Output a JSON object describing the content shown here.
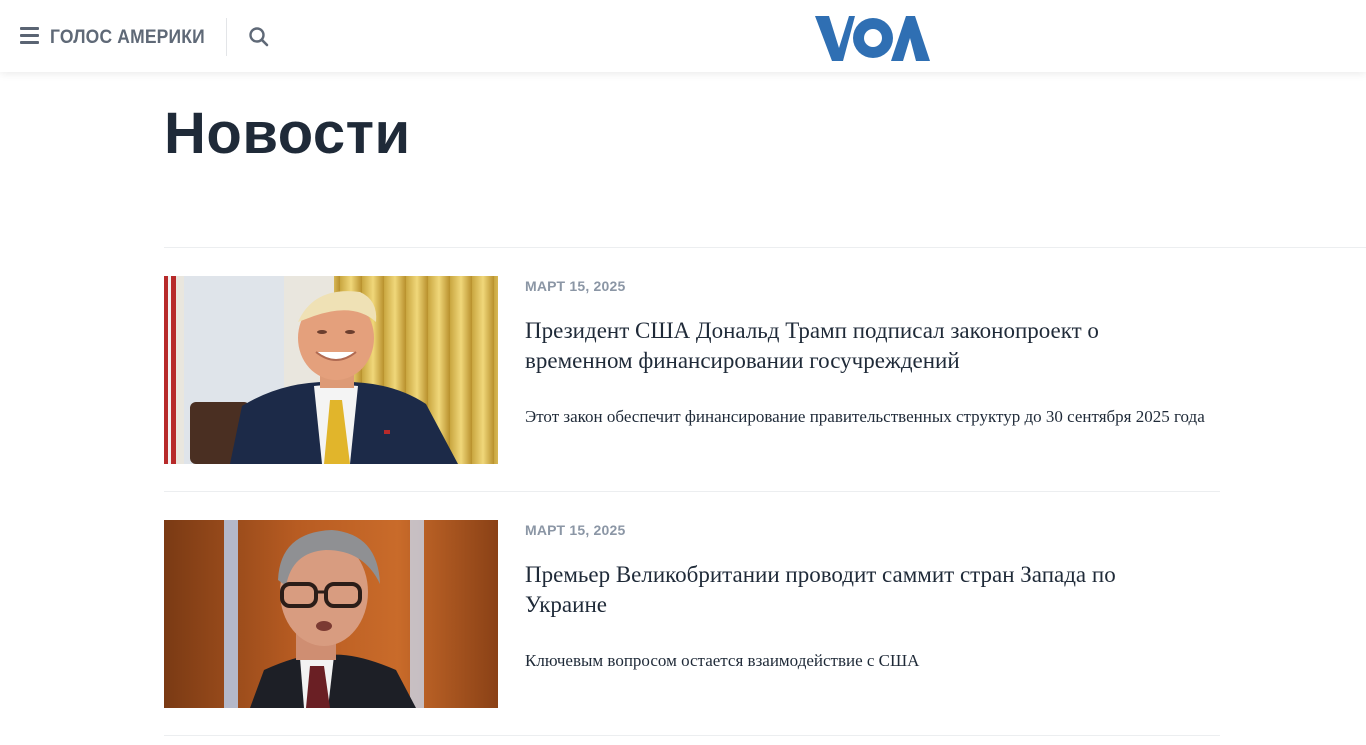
{
  "header": {
    "site_name": "ГОЛОС АМЕРИКИ",
    "logo_text": "VOA",
    "brand_color": "#2f6fb3",
    "menu_icon": "hamburger-menu-icon",
    "search_icon": "search-icon"
  },
  "page": {
    "title": "Новости"
  },
  "articles": [
    {
      "date": "МАРТ 15, 2025",
      "headline": "Президент США Дональд Трамп подписал законопроект о временном финансировании госучреждений",
      "teaser": "Этот закон обеспечит финансирование правительственных структур до 30 сентября 2025 года",
      "image": "photo-smiling-man-oval-office"
    },
    {
      "date": "МАРТ 15, 2025",
      "headline": "Премьер Великобритании проводит саммит стран Запада по Украине",
      "teaser": "Ключевым вопросом остается взаимодействие с США",
      "image": "photo-man-with-glasses-speaking"
    }
  ]
}
